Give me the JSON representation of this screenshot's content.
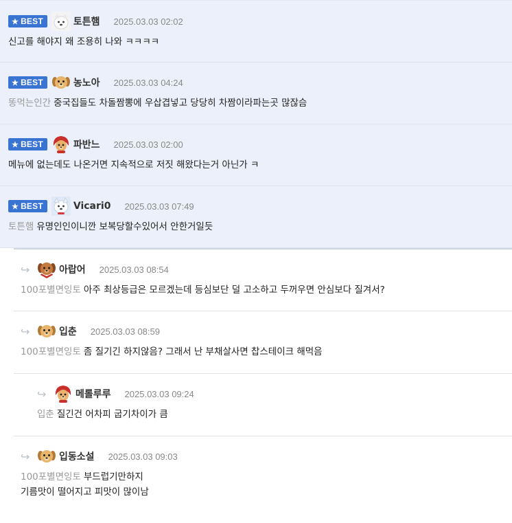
{
  "best_badge": "BEST",
  "best_comments": [
    {
      "nick": "토튼햄",
      "time": "2025.03.03 02:02",
      "mention": "",
      "text": "신고를 해야지 왜 조용히 나와 ㅋㅋㅋㅋ",
      "avatar": "white-dog-avatar"
    },
    {
      "nick": "농노아",
      "time": "2025.03.03 04:24",
      "mention": "똥먹는인간",
      "text": "중국집들도 차돌짬뽕에 우삽겹넣고 당당히 차짬이라파는곳 많잖슴",
      "avatar": "yellow-dog-avatar"
    },
    {
      "nick": "파반느",
      "time": "2025.03.03 02:00",
      "mention": "",
      "text": "메뉴에 없는데도 나온거면 지속적으로 저짓 해왔다는거 아닌가 ㅋ",
      "avatar": "red-hood-dog-avatar"
    },
    {
      "nick": "Vicari0",
      "time": "2025.03.03 07:49",
      "mention": "토튼햄",
      "text": "유명인인이니깐 보복당할수있어서 안한거일듯",
      "avatar": "white-dog-avatar"
    }
  ],
  "replies": [
    {
      "nick": "아랍어",
      "time": "2025.03.03 08:54",
      "mention": "100포별면잉토",
      "text": "아주 최상등급은 모르겠는데 등심보단 덜 고소하고 두꺼우면 안심보다 질겨서?",
      "avatar": "red-scarf-dog-avatar"
    },
    {
      "nick": "입춘",
      "time": "2025.03.03 08:59",
      "mention": "100포별면잉토",
      "text": "좀 질기긴 하지않음? 그래서 난 부채살사면 찹스테이크 해먹음",
      "avatar": "yellow-dog-avatar"
    },
    {
      "nick": "메롤루루",
      "time": "2025.03.03 09:24",
      "mention": "입춘",
      "text": "질긴건 어차피 굽기차이가 큼",
      "avatar": "red-hood-dog-avatar"
    },
    {
      "nick": "입동소설",
      "time": "2025.03.03 09:03",
      "mention": "100포별면잉토",
      "text": "부드럽기만하지\n기름맛이 떨어지고 피맛이 많이남",
      "avatar": "yellow-dog-avatar"
    }
  ],
  "colors": {
    "best_bg": "#ecf0fa",
    "badge": "#3a74d3",
    "mention": "#999999"
  }
}
